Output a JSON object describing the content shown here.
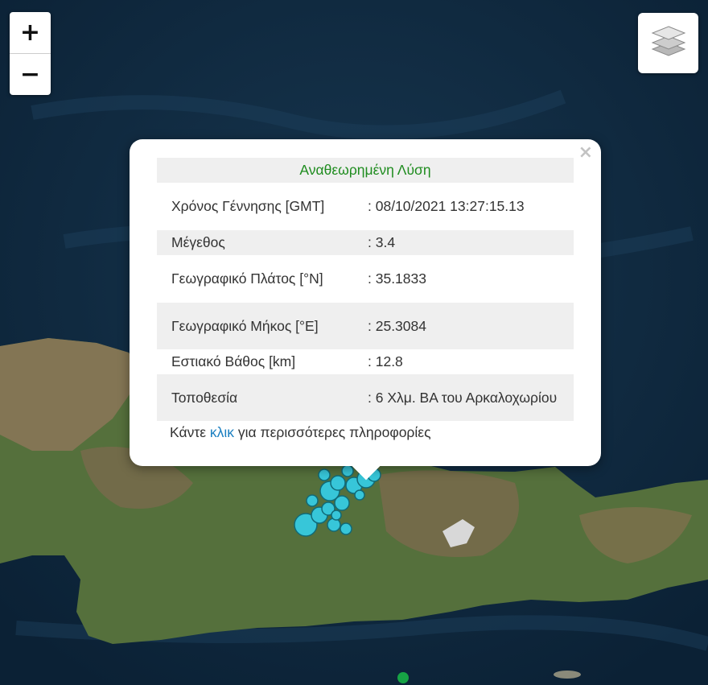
{
  "map": {
    "basemap": "satellite",
    "colors": {
      "sea": "#0f2a40",
      "land": "#4f6838",
      "mountain": "#80664a",
      "marker": "#37c6d9",
      "marker_stroke": "#106a78",
      "marker_small": "#17a345"
    }
  },
  "controls": {
    "zoom_in_label": "+",
    "zoom_out_label": "−",
    "layers_icon": "layers-icon"
  },
  "popup": {
    "close_label": "×",
    "title": "Αναθεωρημένη Λύση",
    "rows": [
      {
        "label": "Χρόνος Γέννησης [GMT]",
        "value": ": 08/10/2021 13:27:15.13"
      },
      {
        "label": "Μέγεθος",
        "value": ": 3.4"
      },
      {
        "label": "Γεωγραφικό Πλάτος [°N]",
        "value": ": 35.1833"
      },
      {
        "label": "Γεωγραφικό Μήκος [°E]",
        "value": ": 25.3084"
      },
      {
        "label": "Εστιακό Βάθος [km]",
        "value": ": 12.8"
      },
      {
        "label": "Τοποθεσία",
        "value": ": 6 Χλμ. ΒΑ του Αρκαλοχωρίου"
      }
    ],
    "footer_before": "Κάντε ",
    "footer_link": "κλικ",
    "footer_after": " για περισσότερες πληροφορίες"
  }
}
